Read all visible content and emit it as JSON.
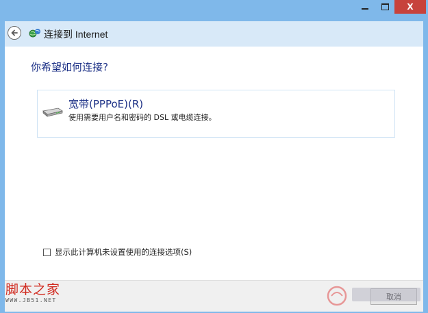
{
  "window": {
    "title": "连接到 Internet",
    "controls": {
      "minimize": "minimize",
      "maximize": "maximize",
      "close": "X"
    }
  },
  "main": {
    "question": "你希望如何连接?",
    "options": [
      {
        "title": "宽带(PPPoE)(R)",
        "description": "使用需要用户名和密码的 DSL 或电缆连接。",
        "icon": "modem-icon"
      }
    ],
    "show_options": {
      "label": "显示此计算机未设置使用的连接选项(S)",
      "checked": false
    }
  },
  "footer": {
    "cancel_label": "取消"
  },
  "watermark": {
    "title": "脚本之家",
    "url": "WWW.JB51.NET"
  },
  "colors": {
    "frame": "#7fb8ea",
    "header": "#d8e9f8",
    "link_text": "#1e3287",
    "close_button": "#c7423c"
  }
}
